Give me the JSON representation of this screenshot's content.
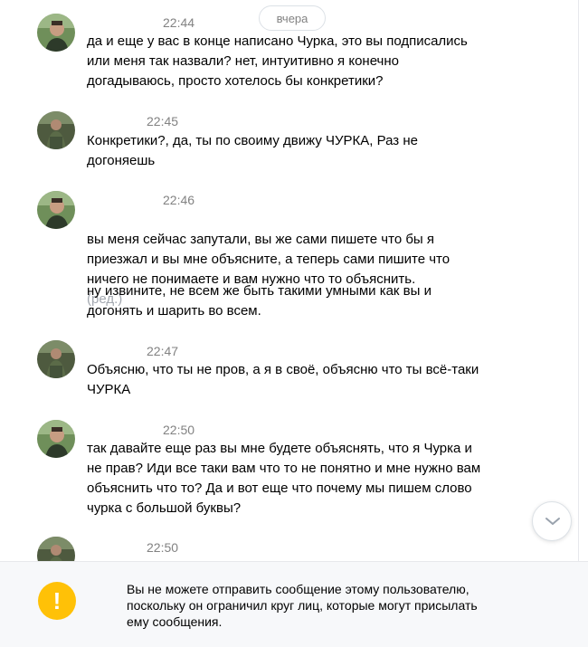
{
  "chat": {
    "date_label": "вчера",
    "messages": [
      {
        "time": "22:44",
        "text": "да и еще у вас в конце написано Чурка, это вы подписались\nили меня так назвали? нет, интуитивно я конечно\nдогадываюсь, просто хотелось бы конкретики?"
      },
      {
        "time": "22:45",
        "text": "Конкретики?, да, ты по своиму движу ЧУРКА, Раз не\nдогоняешь"
      },
      {
        "time": "22:46",
        "text": "вы меня сейчас запутали, вы же сами пишете что бы я\nприезжал и вы мне объясните, а теперь сами пишите что\nничего не понимаете и вам нужно что то объяснить.",
        "edited": "(ред.)",
        "text2": "ну извините, не всем же быть такими умными как вы и\nдогонять и шарить во всем."
      },
      {
        "time": "22:47",
        "text": "Объясню, что ты не пров, а я в своё, объясню что ты всё-таки\nЧУРКА"
      },
      {
        "time": "22:50",
        "text": "так давайте еще раз вы мне будете объяснять, что я Чурка и\nне прав? Иди все таки вам что то не понятно и мне нужно вам\nобъяснить что то? Да и вот еще что почему мы пишем слово\nчурка с большой буквы?"
      },
      {
        "time": "22:50"
      }
    ]
  },
  "icons": {
    "scroll_down": "chevron-down-icon",
    "warning": "exclamation-icon"
  },
  "notice": {
    "icon_glyph": "!",
    "text": "Вы не можете отправить сообщение этому пользователю,\nпоскольку он ограничил круг лиц, которые могут присылать\nему сообщения."
  },
  "colors": {
    "time": "#828282",
    "edited": "#a3a8b0",
    "warning": "#ffc107",
    "notice_bg": "#f7f8fa"
  }
}
